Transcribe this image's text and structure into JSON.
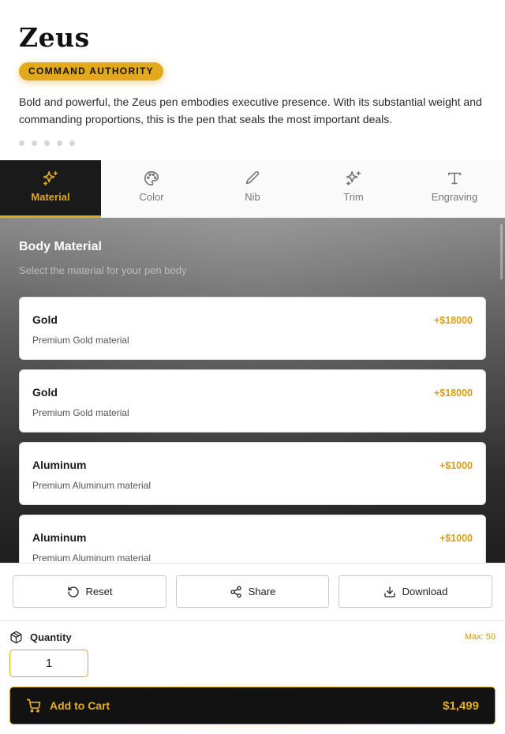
{
  "product": {
    "name": "Zeus",
    "badge": "COMMAND AUTHORITY",
    "description": "Bold and powerful, the Zeus pen embodies executive presence. With its substantial weight and commanding proportions, this is the pen that seals the most important deals.",
    "image_dots": 5
  },
  "tabs": [
    {
      "label": "Material",
      "icon": "sparkles-icon",
      "active": true
    },
    {
      "label": "Color",
      "icon": "palette-icon",
      "active": false
    },
    {
      "label": "Nib",
      "icon": "pen-icon",
      "active": false
    },
    {
      "label": "Trim",
      "icon": "sparkles-icon",
      "active": false
    },
    {
      "label": "Engraving",
      "icon": "type-icon",
      "active": false
    }
  ],
  "panel": {
    "title": "Body Material",
    "subtitle": "Select the material for your pen body",
    "options": [
      {
        "name": "Gold",
        "description": "Premium Gold material",
        "price": "+$18000"
      },
      {
        "name": "Gold",
        "description": "Premium Gold material",
        "price": "+$18000"
      },
      {
        "name": "Aluminum",
        "description": "Premium Aluminum material",
        "price": "+$1000"
      },
      {
        "name": "Aluminum",
        "description": "Premium Aluminum material",
        "price": "+$1000"
      }
    ]
  },
  "actions": {
    "reset": "Reset",
    "share": "Share",
    "download": "Download"
  },
  "quantity": {
    "label": "Quantity",
    "max": "Max: 50",
    "value": "1"
  },
  "cart": {
    "label": "Add to Cart",
    "price": "$1,499"
  },
  "colors": {
    "accent": "#e0a91e",
    "dark": "#121212"
  }
}
